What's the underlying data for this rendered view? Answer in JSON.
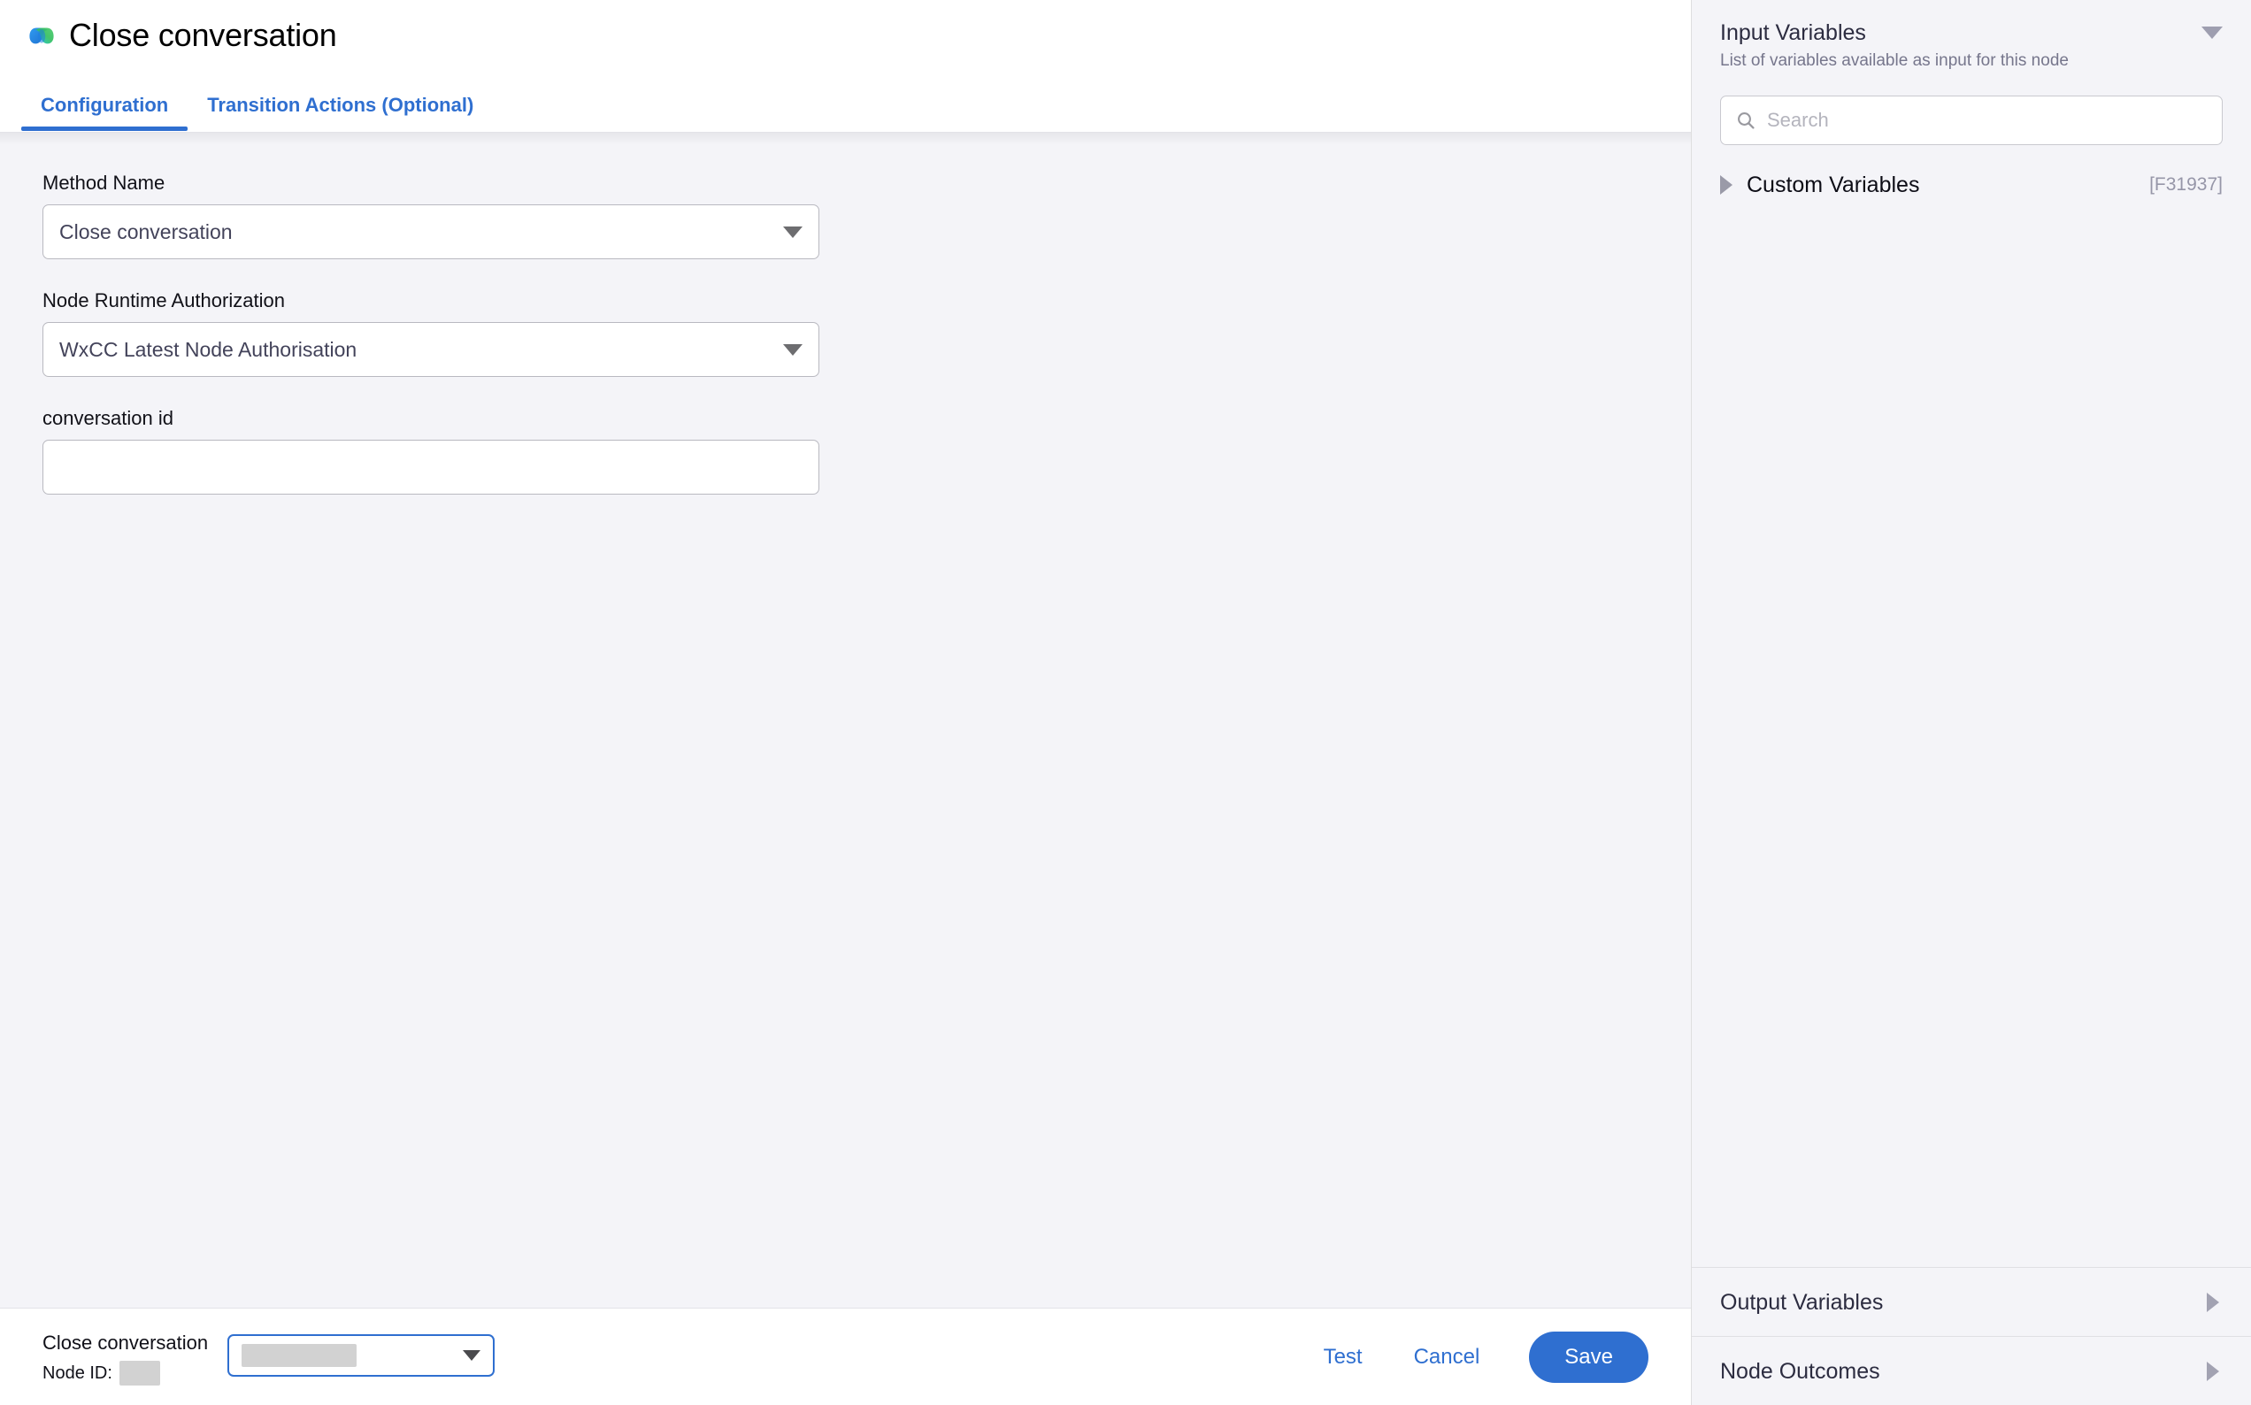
{
  "header": {
    "brand_icon": "webex-logo-icon",
    "title": "Close conversation"
  },
  "tabs": [
    {
      "label": "Configuration",
      "active": true
    },
    {
      "label": "Transition Actions (Optional)",
      "active": false
    }
  ],
  "form": {
    "method_name": {
      "label": "Method Name",
      "value": "Close conversation",
      "caret_icon": "chevron-down-icon"
    },
    "node_runtime_authorization": {
      "label": "Node Runtime Authorization",
      "value": "WxCC Latest Node Authorisation",
      "caret_icon": "chevron-down-icon"
    },
    "conversation_id": {
      "label": "conversation id",
      "value": "",
      "placeholder": ""
    }
  },
  "footer": {
    "node_name": "Close conversation",
    "node_id_label": "Node ID:",
    "node_id_value": "",
    "outcome_select_value": "",
    "outcome_caret_icon": "chevron-down-icon",
    "test_label": "Test",
    "cancel_label": "Cancel",
    "save_label": "Save"
  },
  "right_panel": {
    "input_variables": {
      "title": "Input Variables",
      "subtitle": "List of variables available as input for this node",
      "collapse_icon": "chevron-down-icon",
      "search": {
        "icon": "search-icon",
        "value": "",
        "placeholder": "Search"
      },
      "groups": [
        {
          "expand_icon": "chevron-right-icon",
          "name": "Custom Variables",
          "tag": "[F31937]"
        }
      ]
    },
    "sections": [
      {
        "label": "Output Variables",
        "expand_icon": "chevron-right-icon"
      },
      {
        "label": "Node Outcomes",
        "expand_icon": "chevron-right-icon"
      }
    ]
  },
  "colors": {
    "accent_blue": "#2f6fd0",
    "background": "#f4f4f8",
    "surface": "#ffffff",
    "border": "#b9b9c0",
    "muted_text": "#76768c",
    "redaction": "#d2d2d2"
  }
}
